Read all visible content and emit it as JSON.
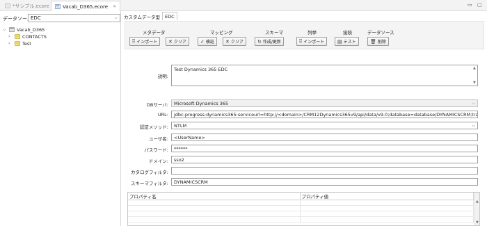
{
  "editor_tabs": [
    {
      "label": "*サンプル.ecore",
      "active": false
    },
    {
      "label": "Vacab_D365.ecore",
      "active": true
    }
  ],
  "left_panel": {
    "datasource_label": "データソース:",
    "datasource_value": "EDC",
    "tree": [
      {
        "label": "Vacab_D365",
        "level": 0,
        "expanded": true
      },
      {
        "label": "CONTACTS",
        "level": 1,
        "expanded": false
      },
      {
        "label": "Test",
        "level": 1,
        "expanded": false
      }
    ]
  },
  "sub_tabs": [
    "カスタムデータ型",
    "EDC"
  ],
  "toolbar": {
    "groups": [
      {
        "title": "メタデータ",
        "buttons": [
          {
            "label": "インポート",
            "icon": "import-icon"
          },
          {
            "label": "クリア",
            "icon": "clear-icon"
          }
        ]
      },
      {
        "title": "マッピング",
        "buttons": [
          {
            "label": "検証",
            "icon": "validate-icon"
          },
          {
            "label": "クリア",
            "icon": "clear-icon"
          }
        ]
      },
      {
        "title": "スキーマ",
        "buttons": [
          {
            "label": "作成/更新",
            "icon": "refresh-icon"
          }
        ]
      },
      {
        "title": "列挙",
        "buttons": [
          {
            "label": "インポート",
            "icon": "import-icon"
          }
        ]
      },
      {
        "title": "接続",
        "buttons": [
          {
            "label": "テスト",
            "icon": "test-icon"
          }
        ]
      },
      {
        "title": "データソース",
        "buttons": [
          {
            "label": "削除",
            "icon": "delete-icon"
          }
        ]
      }
    ]
  },
  "form": {
    "description_label": "説明:",
    "description_value": "Test Dynamics 365 EDC",
    "db_server_label": "DBサーバ:",
    "db_server_value": "Microsoft Dynamics 365",
    "url_label": "URL:",
    "url_value": "jdbc:progress:dynamics365:serviceurl=http://<domain>/CRM12Dynamics365v9/api/data/v9.0;database=database/DYNAMICSCRM;transactio",
    "auth_label": "認証メソッド:",
    "auth_value": "NTLM",
    "user_label": "ユーザ名:",
    "user_value": "<UserName>",
    "password_label": "パスワード:",
    "password_value": "******",
    "domain_label": "ドメイン:",
    "domain_value": "sso2",
    "catalog_label": "カタログフィルタ:",
    "catalog_value": "",
    "schema_label": "スキーマフィルタ:",
    "schema_value": "DYNAMICSCRM"
  },
  "property_table": {
    "headers": [
      "プロパティ名",
      "プロパティ値"
    ],
    "rows": [
      [
        "",
        ""
      ],
      [
        "",
        ""
      ],
      [
        "",
        ""
      ],
      [
        "",
        ""
      ]
    ]
  }
}
